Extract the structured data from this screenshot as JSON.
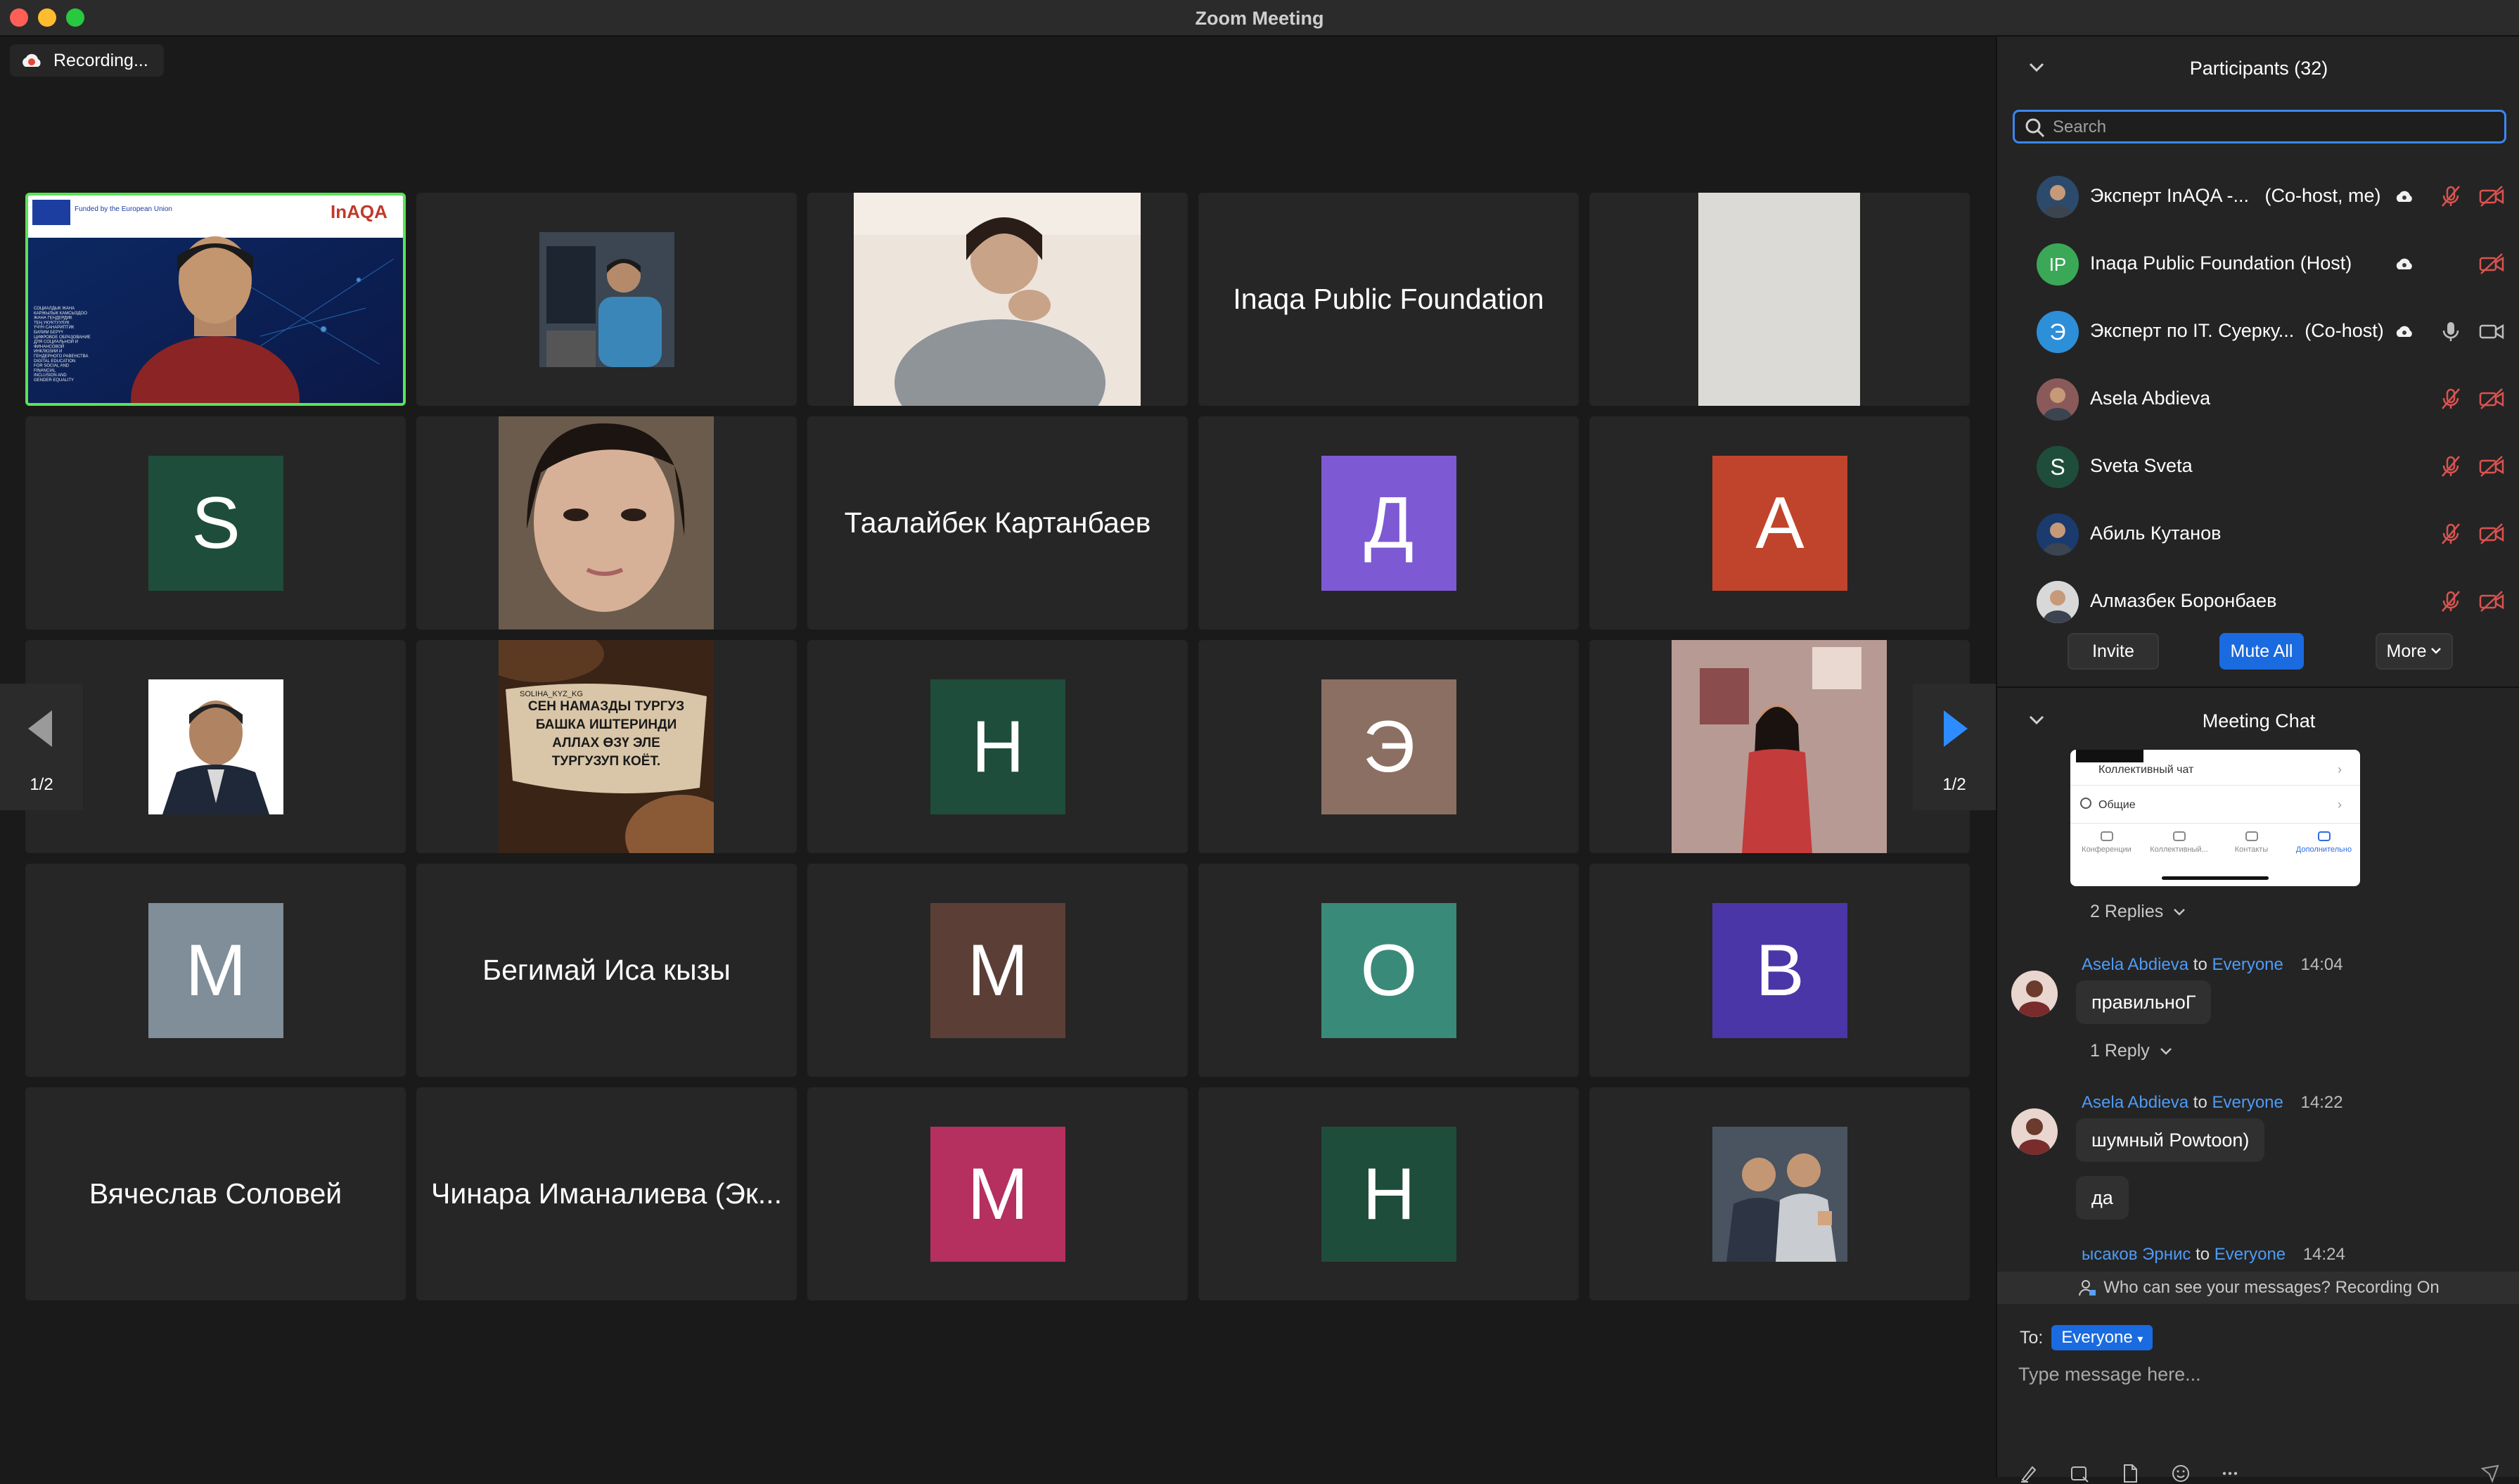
{
  "window": {
    "title": "Zoom Meeting"
  },
  "recording": {
    "label": "Recording..."
  },
  "colors": {
    "accent": "#1a6ae0",
    "active_speaker": "#5be356",
    "muted": "#d9534f",
    "link": "#4e9bf5"
  },
  "grid": {
    "page_indicator": "1/2",
    "tiles": [
      {
        "kind": "video",
        "name": "speaker-video",
        "active": true
      },
      {
        "kind": "photo",
        "name": "photo-man-computer"
      },
      {
        "kind": "photo",
        "name": "photo-woman"
      },
      {
        "kind": "text",
        "label": "Inaqa Public Foundation"
      },
      {
        "kind": "photo",
        "name": "photo-blank"
      },
      {
        "kind": "avatar",
        "letter": "S",
        "color": "#1f4d3b"
      },
      {
        "kind": "photo",
        "name": "photo-woman-selfie"
      },
      {
        "kind": "text",
        "label": "Таалайбек Картанбаев"
      },
      {
        "kind": "avatar",
        "letter": "Д",
        "color": "#7d5ad3"
      },
      {
        "kind": "avatar",
        "letter": "А",
        "color": "#c0442b"
      },
      {
        "kind": "photo",
        "name": "photo-man-portrait"
      },
      {
        "kind": "quote",
        "lines": [
          "СЕН НАМАЗДЫ ТУРГУЗ",
          "БАШКА ИШТЕРИНДИ",
          "АЛЛАХ ӨЗҮ ЭЛЕ",
          "ТУРГУЗУП КОЁТ."
        ],
        "caption": "SOLIHA_KYZ_KG"
      },
      {
        "kind": "avatar",
        "letter": "Н",
        "color": "#1f4d3b"
      },
      {
        "kind": "avatar",
        "letter": "Э",
        "color": "#8b6f62"
      },
      {
        "kind": "photo",
        "name": "photo-woman-standing"
      },
      {
        "kind": "avatar",
        "letter": "М",
        "color": "#7f8e99"
      },
      {
        "kind": "text",
        "label": "Бегимай Иса кызы"
      },
      {
        "kind": "avatar",
        "letter": "М",
        "color": "#5b3f36"
      },
      {
        "kind": "avatar",
        "letter": "О",
        "color": "#3a8a79"
      },
      {
        "kind": "avatar",
        "letter": "В",
        "color": "#4b36a8"
      },
      {
        "kind": "text",
        "label": "Вячеслав Соловей"
      },
      {
        "kind": "text",
        "label": "Чинара Иманалиева (Эк..."
      },
      {
        "kind": "avatar",
        "letter": "М",
        "color": "#b52f5f"
      },
      {
        "kind": "avatar",
        "letter": "Н",
        "color": "#1f4d3b"
      },
      {
        "kind": "photo",
        "name": "photo-two-men"
      }
    ],
    "speaker_slide": {
      "funded_by": "Funded by the European Union",
      "org": "InAQA",
      "lines": [
        "СОЦИАЛДЫК ЖАНА",
        "КАРЖЫЛЫК КАМСЫЗДОО",
        "ЖАНА ГЕНДЕРДИК",
        "ТЕҢ УКУКТУУЛУК",
        "ҮЧҮН САНАРИПТИК",
        "БИЛИМ БЕРҮҮ",
        "ЦИФРОВОЕ ОБРАЗОВАНИЕ",
        "ДЛЯ СОЦИАЛЬНОЙ И",
        "ФИНАНСОВОЙ",
        "ИНКЛЮЗИИ И",
        "ГЕНДЕРНОГО РАВЕНСТВА",
        "DIGITAL EDUCATION",
        "FOR SOCIAL AND",
        "FINANCIAL",
        "INCLUSION AND",
        "GENDER EQUALITY"
      ]
    }
  },
  "participants": {
    "title": "Participants (32)",
    "search_placeholder": "Search",
    "list": [
      {
        "name": "Эксперт InAQA -...   (Co-host, me)",
        "avatar": "photo",
        "color": "#2c4a6b",
        "cloud": true,
        "mic": "muted",
        "video": "off"
      },
      {
        "name": "Inaqa Public Foundation (Host)",
        "avatar": "IP",
        "color": "#3aa856",
        "cloud": true,
        "mic": "none",
        "video": "off"
      },
      {
        "name": "Эксперт по IT. Суерку...  (Co-host)",
        "avatar": "Э",
        "color": "#2d8fd8",
        "cloud": true,
        "mic": "on",
        "video": "on"
      },
      {
        "name": "Asela Abdieva",
        "avatar": "photo",
        "color": "#8a5a5a",
        "cloud": false,
        "mic": "muted",
        "video": "off"
      },
      {
        "name": "Sveta Sveta",
        "avatar": "S",
        "color": "#1f4d3b",
        "cloud": false,
        "mic": "muted",
        "video": "off"
      },
      {
        "name": "Абиль Кутанов",
        "avatar": "photo",
        "color": "#1b3b6e",
        "cloud": false,
        "mic": "muted",
        "video": "off"
      },
      {
        "name": "Алмазбек Боронбаев",
        "avatar": "photo",
        "color": "#d8d8d8",
        "cloud": false,
        "mic": "muted",
        "video": "off"
      }
    ],
    "buttons": {
      "invite": "Invite",
      "mute_all": "Mute All",
      "more": "More"
    }
  },
  "chat": {
    "title": "Meeting Chat",
    "shared_image": {
      "row1": "Коллективный чат",
      "row2": "Общие",
      "tabs": [
        "Конференции",
        "Коллективный...",
        "Контакты",
        "Дополнительно"
      ]
    },
    "replies_1": "2 Replies",
    "messages": [
      {
        "from": "Asela Abdieva",
        "to_word": "to",
        "to": "Everyone",
        "time": "14:04",
        "texts": [
          "правильноГ"
        ],
        "replies": "1 Reply"
      },
      {
        "from": "Asela Abdieva",
        "to_word": "to",
        "to": "Everyone",
        "time": "14:22",
        "texts": [
          "шумный Powtoon)",
          "да"
        ]
      },
      {
        "from": "ыcaков Эрнис",
        "to_word": "to",
        "to": "Everyone",
        "time": "14:24"
      }
    ],
    "privacy": "Who can see your messages? Recording On",
    "to_label": "To:",
    "to_value": "Everyone",
    "input_placeholder": "Type message here..."
  }
}
